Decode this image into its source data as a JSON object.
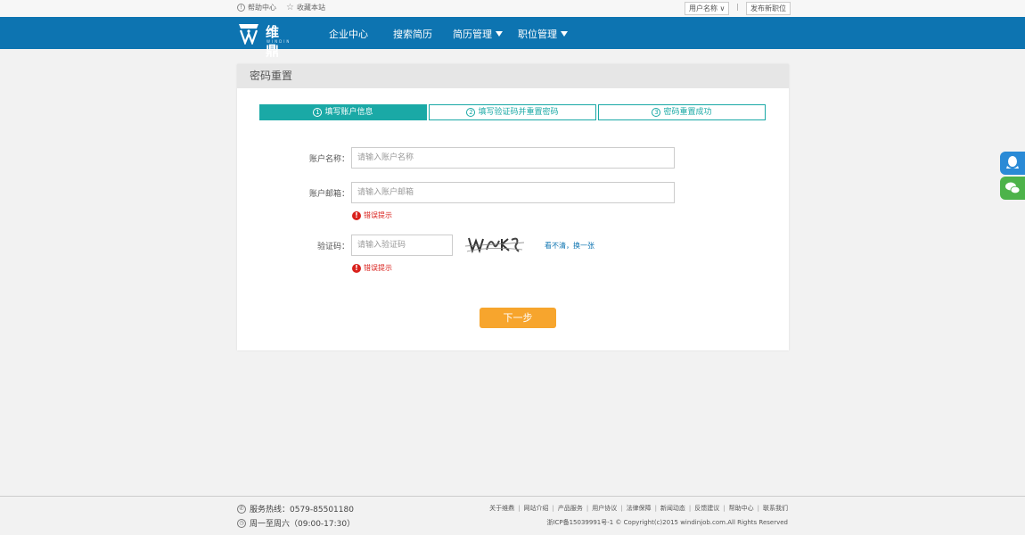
{
  "topbar": {
    "help": "帮助中心",
    "favorite": "收藏本站",
    "username": "用户名称",
    "username_caret": "∨",
    "separator": "|",
    "publish": "发布新职位"
  },
  "nav": {
    "logo_cn": "维鼎",
    "logo_en": "WINDIN",
    "items": [
      {
        "label": "企业中心",
        "dropdown": false
      },
      {
        "label": "搜索简历",
        "dropdown": false
      },
      {
        "label": "简历管理",
        "dropdown": true
      },
      {
        "label": "职位管理",
        "dropdown": true
      }
    ]
  },
  "panel": {
    "title": "密码重置",
    "steps": [
      {
        "num": "1",
        "label": "填写账户信息",
        "active": true
      },
      {
        "num": "2",
        "label": "填写验证码并重置密码",
        "active": false
      },
      {
        "num": "3",
        "label": "密码重置成功",
        "active": false
      }
    ],
    "form": {
      "account_label": "账户名称：",
      "account_placeholder": "请输入账户名称",
      "email_label": "账户邮箱：",
      "email_placeholder": "请输入账户邮箱",
      "email_error": "错误提示",
      "captcha_label": "验证码：",
      "captcha_placeholder": "请输入验证码",
      "captcha_error": "错误提示",
      "captcha_refresh": "看不清，换一张"
    },
    "next_button": "下一步"
  },
  "footer": {
    "hotline": "服务热线：0579-85501180",
    "hours": "周一至周六（09:00-17:30）",
    "links": [
      "关于维鼎",
      "网站介绍",
      "产品服务",
      "用户协议",
      "法律保障",
      "新闻动态",
      "反馈建议",
      "帮助中心",
      "联系我们"
    ],
    "copyright": "浙ICP备15039991号-1 © Copyright(c)2015 windinjob.com.All Rights Reserved"
  },
  "colors": {
    "nav_bg": "#0d74b1",
    "step_active": "#1aa9a6",
    "button": "#f7a52d",
    "error": "#d9211c",
    "qq": "#2a8ad6",
    "wechat": "#4db34a"
  },
  "icons": {
    "help": "info-circle-icon",
    "favorite": "star-icon",
    "qq": "qq-icon",
    "wechat": "wechat-icon",
    "error": "exclamation-icon",
    "phone": "phone-icon",
    "clock": "clock-icon"
  }
}
